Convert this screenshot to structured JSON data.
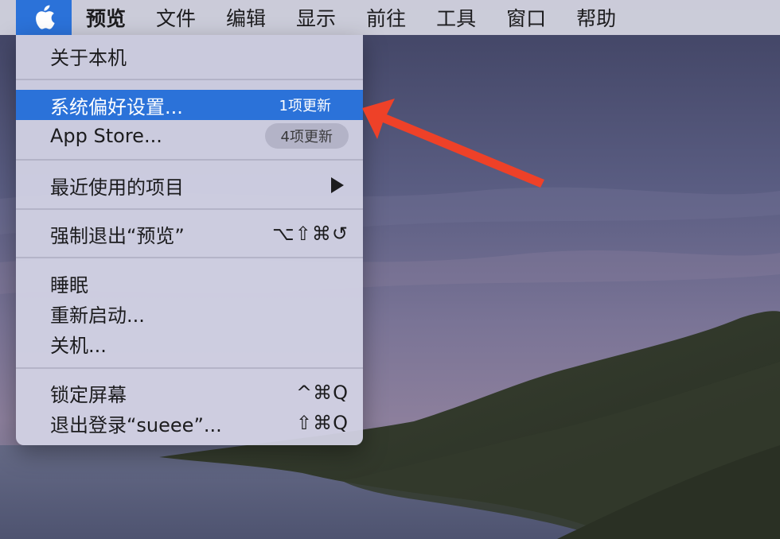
{
  "menubar": {
    "apple_icon": "apple-logo-icon",
    "items": [
      {
        "label": "预览"
      },
      {
        "label": "文件"
      },
      {
        "label": "编辑"
      },
      {
        "label": "显示"
      },
      {
        "label": "前往"
      },
      {
        "label": "工具"
      },
      {
        "label": "窗口"
      },
      {
        "label": "帮助"
      }
    ],
    "accent_color": "#2b72d9"
  },
  "apple_menu": {
    "about": "关于本机",
    "system_prefs": {
      "label": "系统偏好设置...",
      "badge": "1项更新"
    },
    "app_store": {
      "label": "App Store...",
      "badge": "4项更新"
    },
    "recent_items": {
      "label": "最近使用的项目",
      "icon": "submenu-arrow-icon"
    },
    "force_quit": {
      "label": "强制退出“预览”",
      "shortcut": "⌥⇧⌘↺"
    },
    "sleep": "睡眠",
    "restart": "重新启动...",
    "shutdown": "关机...",
    "lock_screen": {
      "label": "锁定屏幕",
      "shortcut": "^⌘Q"
    },
    "logout": {
      "label": "退出登录“sueee”...",
      "shortcut": "⇧⌘Q"
    }
  },
  "annotation": {
    "icon": "red-arrow-icon",
    "color": "#ee4128"
  }
}
